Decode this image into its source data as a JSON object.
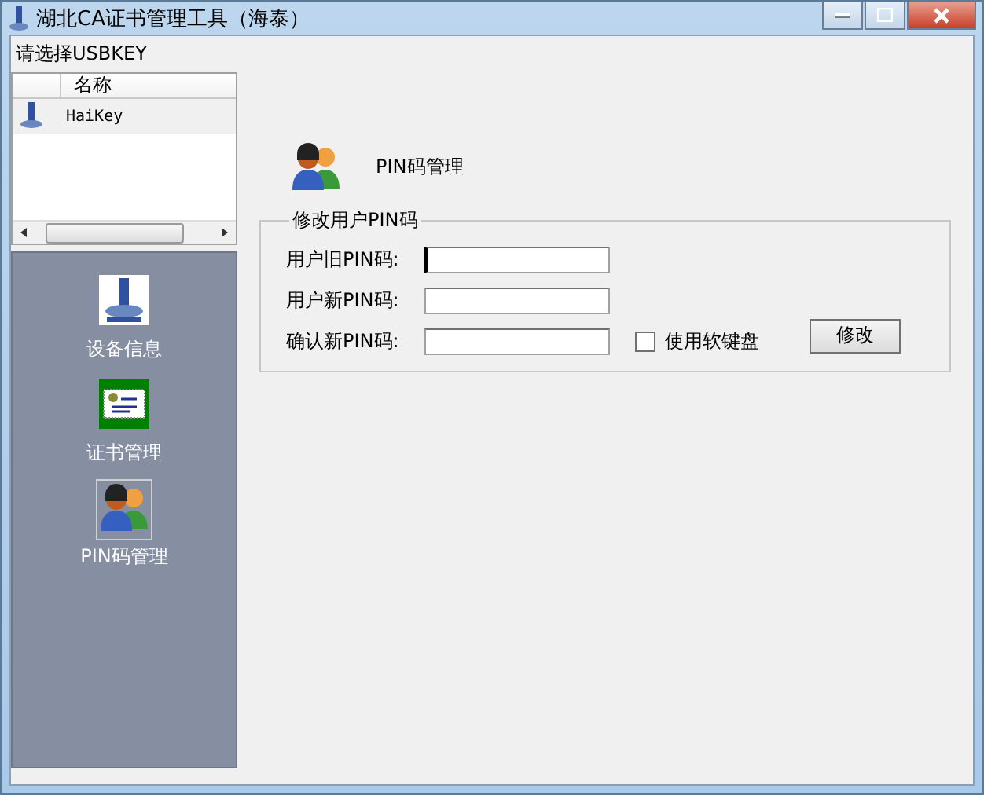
{
  "window": {
    "title": "湖北CA证书管理工具（海泰）"
  },
  "key_list": {
    "label": "请选择USBKEY",
    "columns": [
      "名称"
    ],
    "rows": [
      {
        "name": "HaiKey",
        "selected": true
      }
    ]
  },
  "nav": [
    {
      "label": "设备信息",
      "kind": "device",
      "selected": false
    },
    {
      "label": "证书管理",
      "kind": "cert",
      "selected": false
    },
    {
      "label": "PIN码管理",
      "kind": "pin",
      "selected": true
    }
  ],
  "panel": {
    "title": "PIN码管理",
    "group": "修改用户PIN码",
    "fields": [
      {
        "label": "用户旧PIN码:",
        "focused": true
      },
      {
        "label": "用户新PIN码:",
        "focused": false
      },
      {
        "label": "确认新PIN码:",
        "focused": false
      }
    ],
    "checkbox": {
      "label": "使用软键盘",
      "checked": false
    },
    "button": "修改"
  }
}
